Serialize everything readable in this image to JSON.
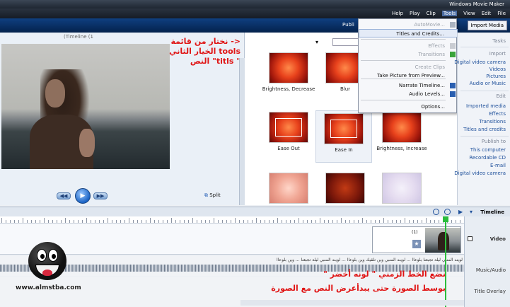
{
  "window": {
    "title": "Windows Movie Maker"
  },
  "menu": {
    "items": [
      "Help",
      "Play",
      "Clip",
      "Tools",
      "View",
      "Edit",
      "File"
    ],
    "active": "Tools"
  },
  "toolbar": {
    "publish_label": "Publi",
    "import_label": "Import Media"
  },
  "preview": {
    "title": "(Timeline (1",
    "split_label": "Split"
  },
  "annotation_top": {
    "line1": "<- نختار من قائمة",
    "line2": "tools الخيار الثاني",
    "line3": "\" titls\" النص"
  },
  "effects": [
    {
      "label": "Brightness, Decrease",
      "style": "normal"
    },
    {
      "label": "Blur",
      "style": "normal"
    },
    {
      "label": "Ease Out",
      "style": "normal"
    },
    {
      "label": "Ease In",
      "style": "normal"
    },
    {
      "label": "Brightness, Increase",
      "style": "normal"
    },
    {
      "label": "",
      "style": "light"
    },
    {
      "label": "",
      "style": "dark"
    },
    {
      "label": "",
      "style": "pale"
    }
  ],
  "tools_menu": {
    "items": [
      {
        "label": "AutoMovie...",
        "disabled": true
      },
      {
        "label": "Titles and Credits...",
        "disabled": false,
        "highlight": true
      },
      {
        "label": "Effects",
        "disabled": true
      },
      {
        "label": "Transitions",
        "disabled": true
      },
      {
        "label": "Create Clips",
        "disabled": true
      },
      {
        "label": "Take Picture from Preview...",
        "disabled": false
      },
      {
        "label": "Narrate Timeline...",
        "disabled": false
      },
      {
        "label": "Audio Levels...",
        "disabled": false
      },
      {
        "label": "Options...",
        "disabled": false
      }
    ]
  },
  "tasks": {
    "title": "Tasks",
    "import_header": "Import",
    "import_links": [
      "Digital video camera",
      "Videos",
      "Pictures",
      "Audio or Music"
    ],
    "edit_header": "Edit",
    "edit_links": [
      "Imported media",
      "Effects",
      "Transitions",
      "Titles and credits"
    ],
    "publish_header": "Publish to",
    "publish_links": [
      "This computer",
      "Recordable CD",
      "E-mail",
      "Digital video camera"
    ]
  },
  "timeline": {
    "title": "Timeline",
    "tracks": [
      "Video",
      "Music/Audio",
      "Title Overlay"
    ],
    "clip_number": "(1)",
    "audio_text": "لوينه المنبي ليلة تجبعنا بلوعاا ...   لوينه المنبي وين تلقيك وين بلوعاا ...   لوينه المنبي ليلة تجبعنا ...   وين بلوعاا"
  },
  "annotation_bottom": {
    "line1": "نضع الخط الزمني \" لونه أخضر \"",
    "line2": "بوسط الصورة حتى يبدأعرض النص مع الصورة"
  },
  "watermark": {
    "url": "www.almstba.com"
  },
  "colors": {
    "annotation": "#e01414",
    "playhead": "#2bbd3c",
    "toolbar": "#0a3268"
  }
}
